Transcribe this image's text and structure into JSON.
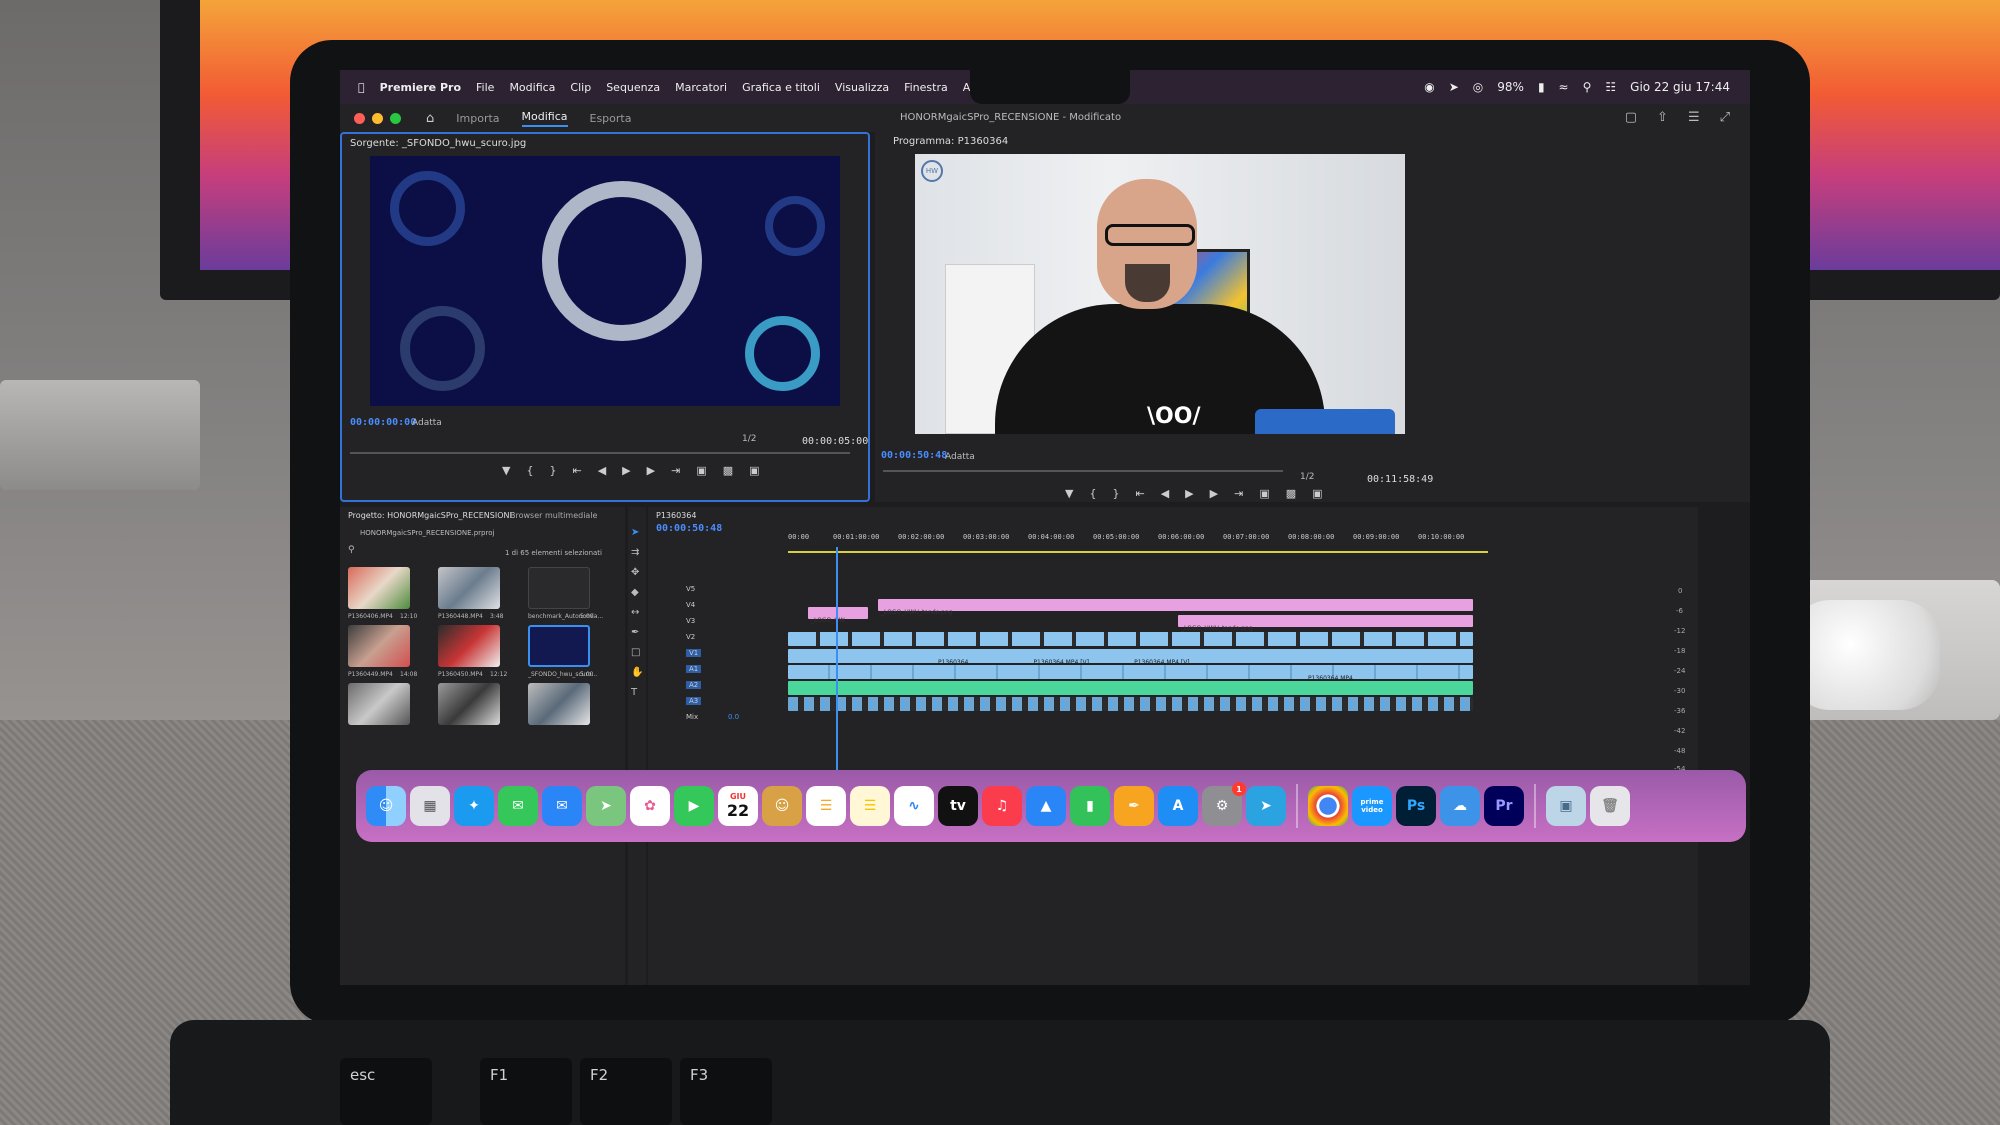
{
  "menubar": {
    "app_name": "Premiere Pro",
    "items": [
      "File",
      "Modifica",
      "Clip",
      "Sequenza",
      "Marcatori",
      "Grafica e titoli",
      "Visualizza",
      "Finestra",
      "Aiuto"
    ],
    "battery": "98%",
    "datetime": "Gio 22 giu  17:44"
  },
  "titlebar": {
    "tabs": [
      "Importa",
      "Modifica",
      "Esporta"
    ],
    "active_tab": "Modifica",
    "document": "HONORMgaicSPro_RECENSIONE - Modificato"
  },
  "source": {
    "title": "Sorgente: _SFONDO_hwu_scuro.jpg",
    "timecode_in": "00:00:00:00",
    "fit": "Adatta",
    "resolution": "1/2",
    "duration": "00:00:05:00"
  },
  "program": {
    "title": "Programma: P1360364",
    "timecode": "00:00:50:48",
    "fit": "Adatta",
    "resolution": "1/2",
    "duration": "00:11:58:49",
    "watermark": "HW",
    "shirt_text": "\\OO/"
  },
  "project": {
    "title": "Progetto: HONORMgaicSPro_RECENSIONE",
    "tab2": "Browser multimediale",
    "file": "HONORMgaicSPro_RECENSIONE.prproj",
    "selection": "1 di 65 elementi selezionati",
    "items": [
      {
        "name": "P1360406.MP4",
        "duration": "12:10"
      },
      {
        "name": "P1360448.MP4",
        "duration": "3:48"
      },
      {
        "name": "benchmark_Autonomia...",
        "duration": "5:00"
      },
      {
        "name": "P1360449.MP4",
        "duration": "14:08"
      },
      {
        "name": "P1360450.MP4",
        "duration": "12:12"
      },
      {
        "name": "_SFONDO_hwu_scuro...",
        "duration": "5:00"
      }
    ]
  },
  "timeline": {
    "sequence": "P1360364",
    "timecode": "00:00:50:48",
    "ruler": [
      "00:00",
      "00:01:00:00",
      "00:02:00:00",
      "00:03:00:00",
      "00:04:00:00",
      "00:05:00:00",
      "00:06:00:00",
      "00:07:00:00",
      "00:08:00:00",
      "00:09:00:00",
      "00:10:00:00"
    ],
    "tracks": [
      "V5",
      "V4",
      "V3",
      "V2",
      "V1",
      "A1",
      "A2",
      "A3",
      "Mix"
    ],
    "mix_value": "0.0",
    "clip_labels": {
      "logo1": "_LOGO_HWU_tondo.png",
      "logo2": "_LOGO_HWU_tondo.png",
      "logo3": "_LOGO_HW",
      "v1a": "P1360364",
      "v1b": "P1360364.MP4 [V]",
      "v1c": "P1360364.MP4 [V]",
      "a1": "P1360364.MP4"
    },
    "meter_scale": [
      "0",
      "-6",
      "-12",
      "-18",
      "-24",
      "-30",
      "-36",
      "-42",
      "-48",
      "-54"
    ]
  },
  "dock": {
    "calendar_month": "GIU",
    "calendar_day": "22",
    "apps": [
      "Finder",
      "Launchpad",
      "Safari",
      "Messaggi",
      "Mail",
      "Mappe",
      "Foto",
      "FaceTime",
      "Calendario",
      "Contatti",
      "Promemoria",
      "Note",
      "Freeform",
      "TV",
      "Musica",
      "Keynote",
      "Numbers",
      "Pages",
      "App Store",
      "Impostazioni",
      "Telegram",
      "Chrome",
      "Prime Video",
      "Photoshop",
      "Meteo",
      "Premiere Pro",
      "Anteprima",
      "Cestino"
    ],
    "ps_label": "Ps",
    "pr_label": "Pr",
    "tv_label": "tv",
    "prime_label": "prime video",
    "settings_badge": "1"
  },
  "keyboard": {
    "keys": [
      "esc",
      "F1",
      "F2",
      "F3"
    ]
  },
  "colors": {
    "accent": "#3b8ff0",
    "video_clip": "#8ec5ef",
    "graphic_clip": "#e8a1e0",
    "audio_clip": "#4bd69c",
    "source_bg": "#0b0f45"
  }
}
